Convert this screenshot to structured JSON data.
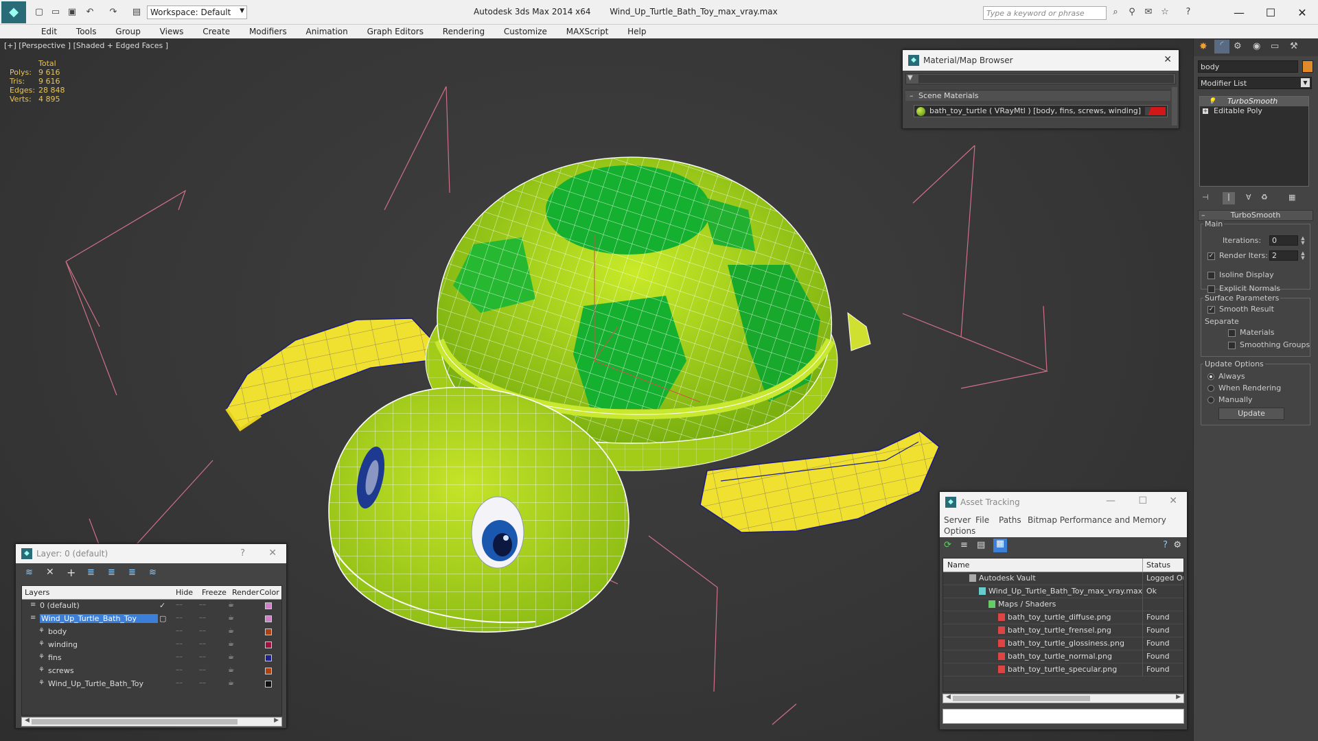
{
  "app": {
    "title": "Autodesk 3ds Max  2014 x64",
    "file": "Wind_Up_Turtle_Bath_Toy_max_vray.max",
    "workspace": "Workspace: Default",
    "search_placeholder": "Type a keyword or phrase"
  },
  "menu": [
    "Edit",
    "Tools",
    "Group",
    "Views",
    "Create",
    "Modifiers",
    "Animation",
    "Graph Editors",
    "Rendering",
    "Customize",
    "MAXScript",
    "Help"
  ],
  "viewport": {
    "label": "[+] [Perspective ] [Shaded + Edged Faces ]",
    "stats": {
      "header": "Total",
      "rows": [
        {
          "k": "Polys:",
          "v": "9 616"
        },
        {
          "k": "Tris:",
          "v": "9 616"
        },
        {
          "k": "Edges:",
          "v": "28 848"
        },
        {
          "k": "Verts:",
          "v": "4 895"
        }
      ]
    }
  },
  "material_browser": {
    "title": "Material/Map Browser",
    "section": "Scene Materials",
    "item": "bath_toy_turtle  ( VRayMtl ) [body, fins, screws, winding]"
  },
  "command_panel": {
    "object_name": "body",
    "modifier_list": "Modifier List",
    "stack": [
      "TurboSmooth",
      "Editable Poly"
    ],
    "rollout": "TurboSmooth",
    "main_group": "Main",
    "iterations_label": "Iterations:",
    "iterations_value": "0",
    "render_iters_label": "Render Iters:",
    "render_iters_value": "2",
    "isoline": "Isoline Display",
    "explicit_normals": "Explicit Normals",
    "surface_params": "Surface Parameters",
    "smooth_result": "Smooth Result",
    "separate": "Separate",
    "materials": "Materials",
    "smoothing_groups": "Smoothing Groups",
    "update_options": "Update Options",
    "always": "Always",
    "when_rendering": "When Rendering",
    "manually": "Manually",
    "update_btn": "Update"
  },
  "layer_dialog": {
    "title": "Layer: 0 (default)",
    "columns": [
      "Layers",
      "Hide",
      "Freeze",
      "Render",
      "Color"
    ],
    "rows": [
      {
        "name": "0 (default)",
        "indent": 0,
        "color": "#d080c8",
        "selected": false
      },
      {
        "name": "Wind_Up_Turtle_Bath_Toy",
        "indent": 0,
        "color": "#d080c8",
        "selected": true
      },
      {
        "name": "body",
        "indent": 1,
        "color": "#b04010",
        "selected": false
      },
      {
        "name": "winding",
        "indent": 1,
        "color": "#a01040",
        "selected": false
      },
      {
        "name": "fins",
        "indent": 1,
        "color": "#202090",
        "selected": false
      },
      {
        "name": "screws",
        "indent": 1,
        "color": "#b04010",
        "selected": false
      },
      {
        "name": "Wind_Up_Turtle_Bath_Toy",
        "indent": 1,
        "color": "#101010",
        "selected": false
      }
    ]
  },
  "asset_tracking": {
    "title": "Asset Tracking",
    "menu": [
      "Server",
      "File",
      "Paths",
      "Bitmap Performance and Memory"
    ],
    "menu2": "Options",
    "columns": [
      "Name",
      "Status"
    ],
    "rows": [
      {
        "name": "Autodesk Vault",
        "status": "Logged Ou",
        "indent": 1
      },
      {
        "name": "Wind_Up_Turtle_Bath_Toy_max_vray.max",
        "status": "Ok",
        "indent": 2
      },
      {
        "name": "Maps / Shaders",
        "status": "",
        "indent": 3
      },
      {
        "name": "bath_toy_turtle_diffuse.png",
        "status": "Found",
        "indent": 4
      },
      {
        "name": "bath_toy_turtle_frensel.png",
        "status": "Found",
        "indent": 4
      },
      {
        "name": "bath_toy_turtle_glossiness.png",
        "status": "Found",
        "indent": 4
      },
      {
        "name": "bath_toy_turtle_normal.png",
        "status": "Found",
        "indent": 4
      },
      {
        "name": "bath_toy_turtle_specular.png",
        "status": "Found",
        "indent": 4
      }
    ]
  },
  "colors": {
    "shell_light": "#b8e020",
    "shell_dark": "#16b030",
    "fin_yellow": "#f0e030",
    "selection_blue": "#3c7fd8"
  }
}
